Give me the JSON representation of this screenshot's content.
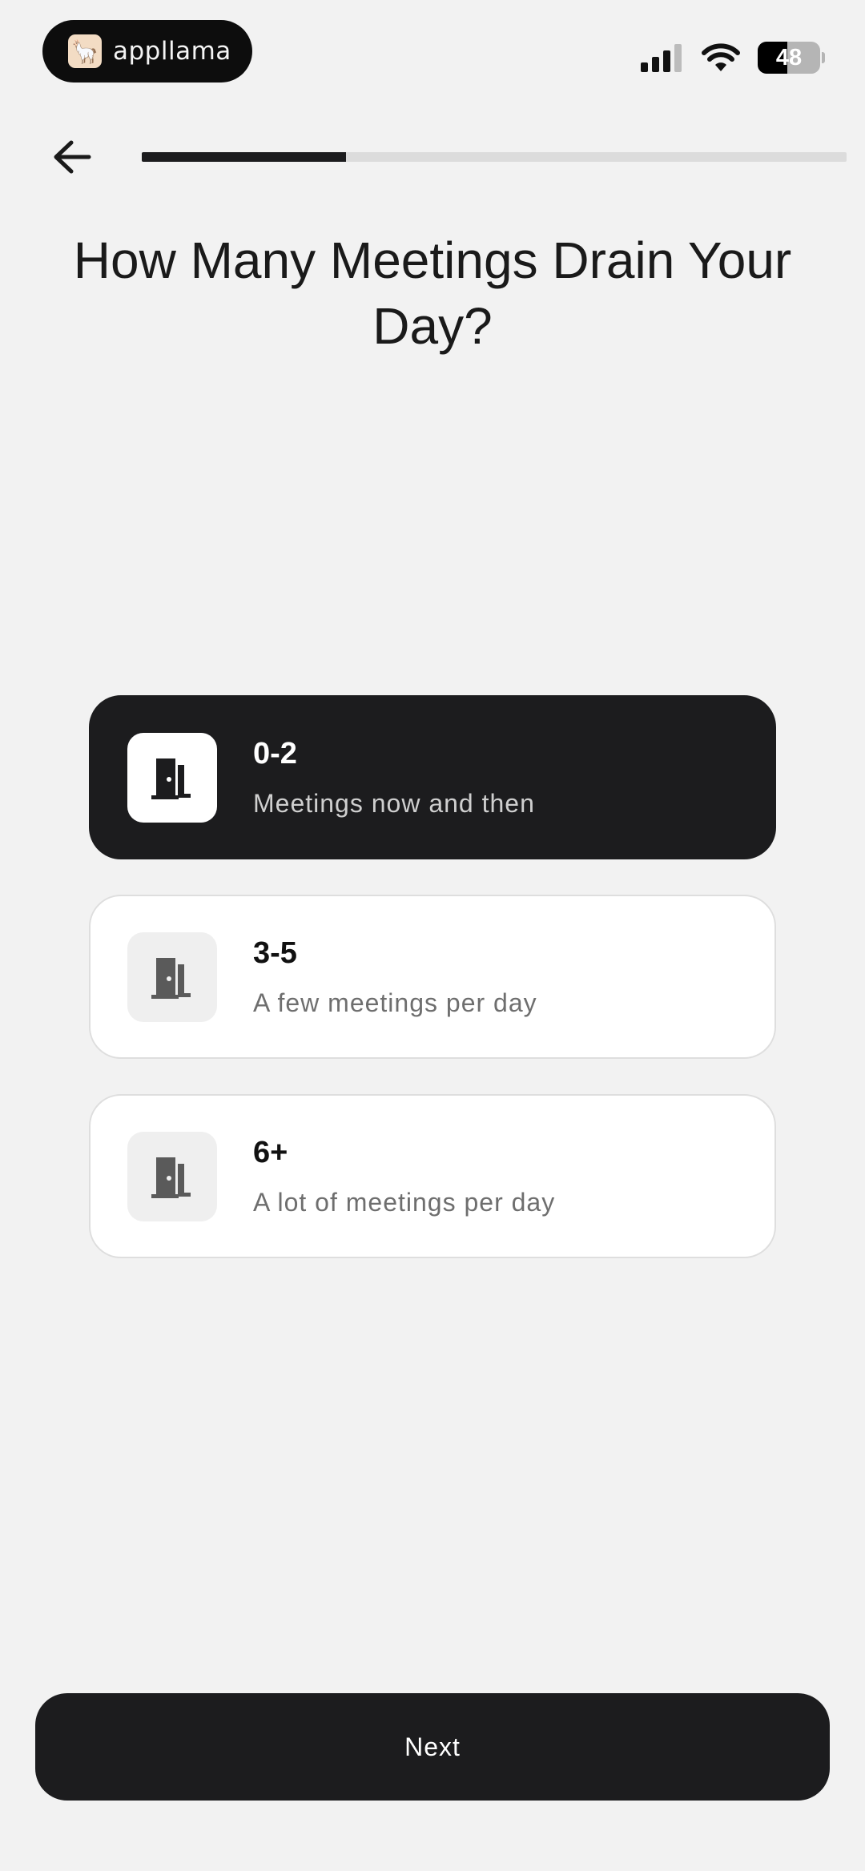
{
  "status_bar": {
    "brand_name": "appllama",
    "battery_level": "48",
    "battery_fraction": 0.48,
    "icons": [
      "cellular-signal-icon",
      "wifi-icon",
      "battery-icon"
    ]
  },
  "nav": {
    "back_icon": "arrow-left-icon",
    "progress_fraction": 0.29
  },
  "question": {
    "title": "How Many Meetings Drain Your Day?"
  },
  "options": [
    {
      "title": "0-2",
      "subtitle": "Meetings now and then",
      "icon": "door-icon",
      "selected": true
    },
    {
      "title": "3-5",
      "subtitle": "A few meetings per day",
      "icon": "door-icon",
      "selected": false
    },
    {
      "title": "6+",
      "subtitle": "A lot of meetings per day",
      "icon": "door-icon",
      "selected": false
    }
  ],
  "footer": {
    "next_label": "Next"
  },
  "colors": {
    "background": "#f2f2f2",
    "primary": "#1c1c1e",
    "card": "#ffffff",
    "progress_track": "#dcdcdc"
  }
}
